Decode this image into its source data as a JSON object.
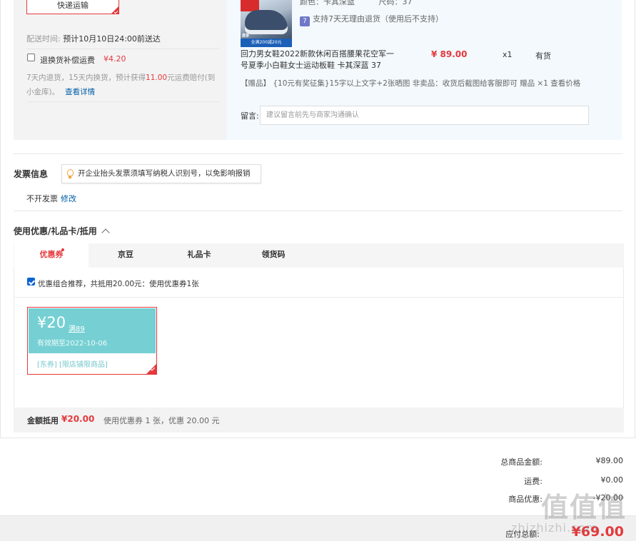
{
  "shipping": {
    "express_label": "快递运输",
    "time_label": "配送时间:",
    "time_value": "预计10月10日24:00前送达",
    "insurance_label": "退换货补偿运费",
    "insurance_price": "¥4.20",
    "insurance_desc_a": "7天内退货，15天内换货，预计获得",
    "insurance_desc_amount": "11.00",
    "insurance_desc_b": "元运费赔付(到小金库)。",
    "insurance_link": "查看详情"
  },
  "product": {
    "image_price": "89",
    "image_banner": "全满200减20元",
    "color_label": "颜色：卡其深蓝",
    "size_label": "尺码：37",
    "support_icon": "7",
    "support_text": "支持7天无理由退货（使用后不支持）",
    "name": "回力男女鞋2022新款休闲百搭腰果花空军一号夏季小白鞋女士运动板鞋 卡其深蓝 37",
    "price": "¥ 89.00",
    "qty": "x1",
    "stock": "有货",
    "gift": "【赠品】 {10元有奖征集}15字以上文字+2张晒图 非卖品：收货后截图给客服即可 赠品 ×1  查看价格",
    "msg_label": "留言:",
    "msg_placeholder": "建议留言前先与商家沟通确认"
  },
  "invoice": {
    "title": "发票信息",
    "tip": "开企业抬头发票须填写纳税人识别号，以免影响报销",
    "value": "不开发票",
    "edit_link": "修改"
  },
  "coupons": {
    "title": "使用优惠/礼品卡/抵用",
    "tabs": [
      "优惠券",
      "京豆",
      "礼品卡",
      "领货码"
    ],
    "combo_label": "优惠组合推荐，共抵用20.00元：使用优惠券1张",
    "card": {
      "amount": "¥20",
      "condition": "满89",
      "expiry": "有效期至2022-10-06",
      "tags": "[东券] [限店铺限商品]"
    },
    "summary_label": "金额抵用",
    "summary_amount": "¥20.00",
    "summary_desc": "使用优惠券 1 张，优惠 20.00 元"
  },
  "totals": {
    "goods_label": "总商品金额:",
    "goods_value": "¥89.00",
    "freight_label": "运费:",
    "freight_value": "¥0.00",
    "discount_label": "商品优惠:",
    "discount_value": "-¥20.00",
    "pay_label": "应付总额:",
    "pay_value": "¥69.00"
  },
  "watermark": {
    "main": "值值值",
    "sub": "zhizhizhi.com"
  }
}
